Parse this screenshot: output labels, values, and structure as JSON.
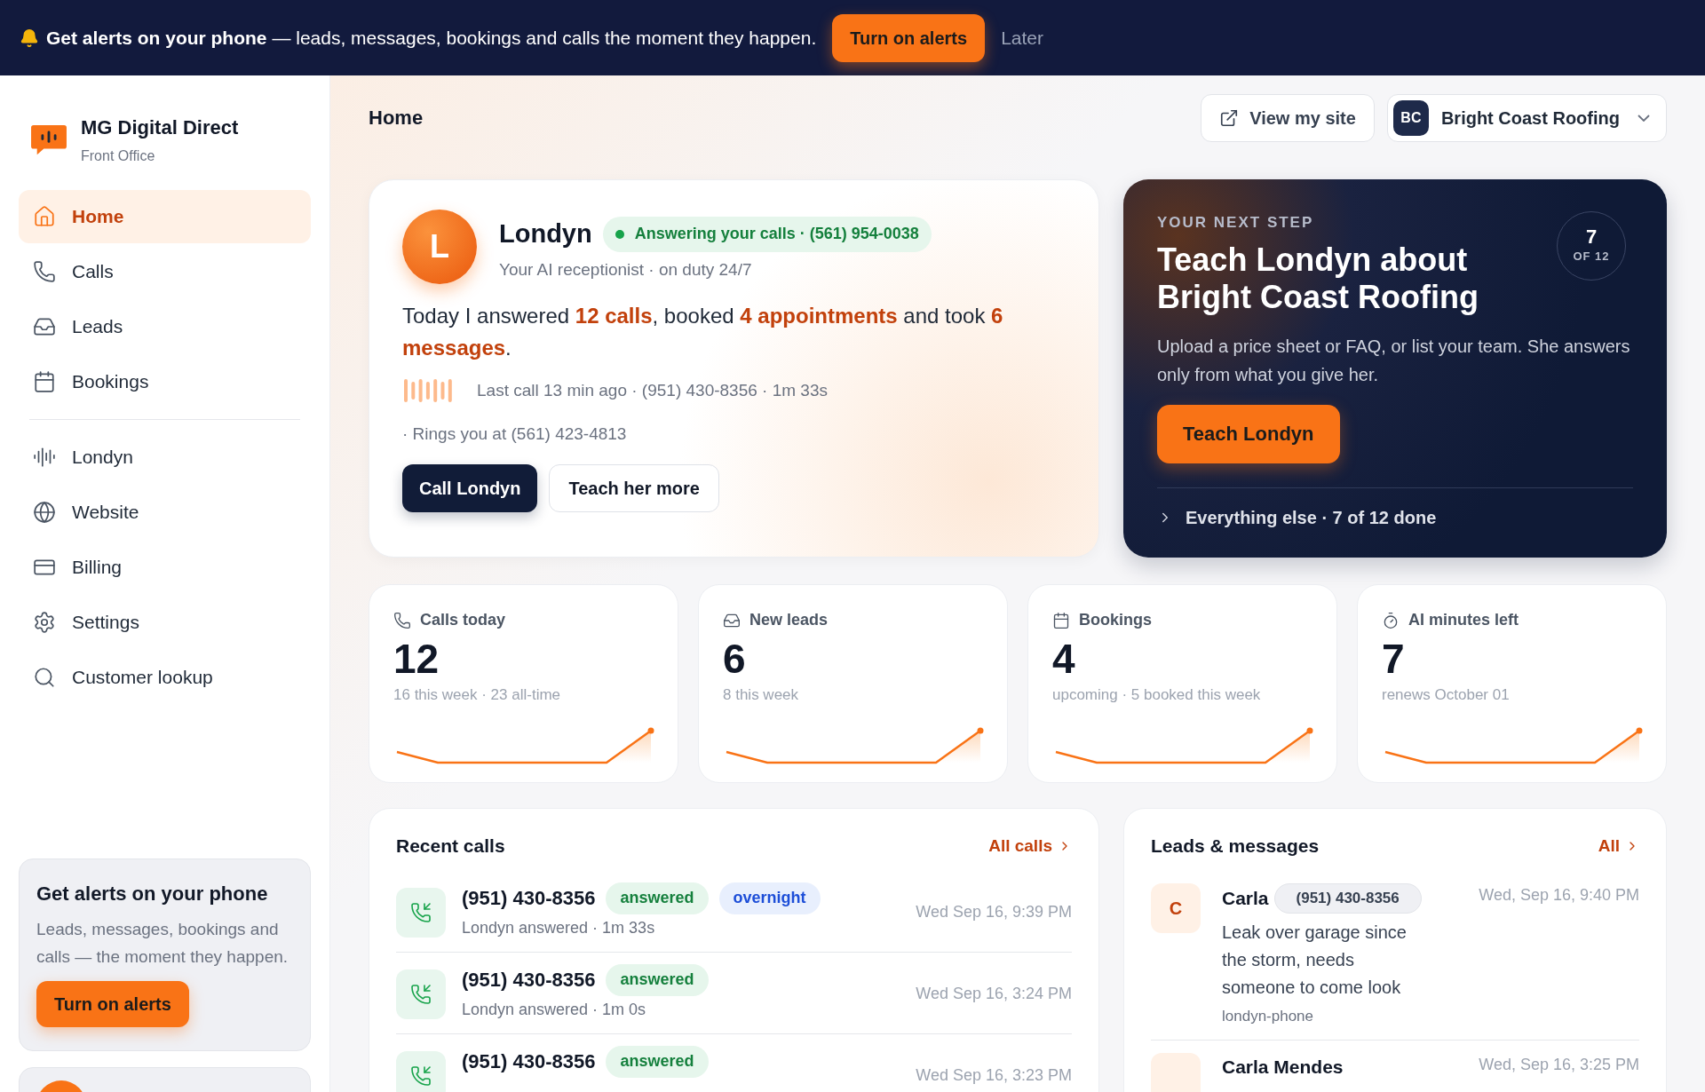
{
  "alert_banner": {
    "title": "Get alerts on your phone",
    "text": "— leads, messages, bookings and calls the moment they happen.",
    "primary_button": "Turn on alerts",
    "secondary_button": "Later"
  },
  "sidebar": {
    "brand": {
      "name": "MG Digital Direct",
      "subtitle": "Front Office"
    },
    "nav_groups": [
      [
        {
          "label": "Home",
          "selected": true
        },
        {
          "label": "Calls",
          "selected": false
        },
        {
          "label": "Leads",
          "selected": false
        },
        {
          "label": "Bookings",
          "selected": false
        }
      ],
      [
        {
          "label": "Londyn",
          "selected": false
        },
        {
          "label": "Website",
          "selected": false
        },
        {
          "label": "Billing",
          "selected": false
        },
        {
          "label": "Settings",
          "selected": false
        },
        {
          "label": "Customer lookup",
          "selected": false
        }
      ]
    ],
    "promo": {
      "title": "Get alerts on your phone",
      "text": "Leads, messages, bookings and calls — the moment they happen.",
      "button": "Turn on alerts"
    }
  },
  "header": {
    "title": "Home",
    "view_site_button": "View my site",
    "account": {
      "initials": "BC",
      "name": "Bright Coast Roofing"
    }
  },
  "hero": {
    "avatar_letter": "L",
    "name": "Londyn",
    "status": "Answering your calls · (561) 954-0038",
    "subtitle": "Your AI receptionist · on duty 24/7",
    "summary": "Today I answered **12 calls**, booked **4 appointments** and took **6 messages**.",
    "last_call": "Last call 13 min ago · (951) 430-8356 · 1m 33s",
    "rings": "· Rings you at (561) 423-4813",
    "primary_button": "Call Londyn",
    "secondary_button": "Teach her more"
  },
  "next_step": {
    "eyebrow": "YOUR NEXT STEP",
    "title": "Teach Londyn about Bright Coast Roofing",
    "progress_value": "7",
    "progress_label": "OF 12",
    "text": "Upload a price sheet or FAQ, or list your team. She answers only from what you give her.",
    "button": "Teach Londyn",
    "footer": "Everything else · 7 of 12 done"
  },
  "stats": [
    {
      "label": "Calls today",
      "value": "12",
      "detail": "16 this week · 23 all-time"
    },
    {
      "label": "New leads",
      "value": "6",
      "detail": "8 this week"
    },
    {
      "label": "Bookings",
      "value": "4",
      "detail": "upcoming · 5 booked this week"
    },
    {
      "label": "AI minutes left",
      "value": "7",
      "detail": "renews October 01"
    }
  ],
  "recent_calls": {
    "title": "Recent calls",
    "link": "All calls",
    "rows": [
      {
        "number": "(951) 430-8356",
        "badges": [
          {
            "label": "answered",
            "kind": "status"
          },
          {
            "label": "overnight",
            "kind": "tag"
          }
        ],
        "detail": "Londyn answered · 1m 33s",
        "time": "Wed Sep 16, 9:39 PM"
      },
      {
        "number": "(951) 430-8356",
        "badges": [
          {
            "label": "answered",
            "kind": "status"
          }
        ],
        "detail": "Londyn answered · 1m 0s",
        "time": "Wed Sep 16, 3:24 PM"
      },
      {
        "number": "(951) 430-8356",
        "badges": [
          {
            "label": "answered",
            "kind": "status"
          }
        ],
        "time": "Wed Sep 16, 3:23 PM"
      }
    ]
  },
  "leads": {
    "title": "Leads & messages",
    "link": "All",
    "rows": [
      {
        "initial": "C",
        "name": "Carla",
        "phone": "(951) 430-8356",
        "message": "Leak over garage since the storm, needs someone to come look",
        "source": "londyn-phone",
        "time": "Wed, Sep 16, 9:40 PM"
      },
      {
        "name": "Carla Mendes",
        "time": "Wed, Sep 16, 3:25 PM"
      }
    ]
  }
}
